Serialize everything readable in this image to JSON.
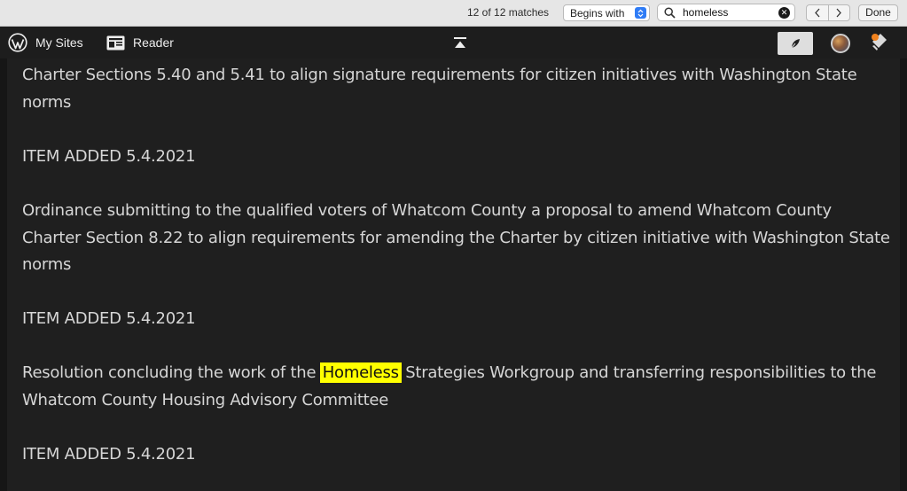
{
  "findbar": {
    "match_count": "12 of 12 matches",
    "mode": "Begins with",
    "query": "homeless",
    "done_label": "Done"
  },
  "adminbar": {
    "my_sites": "My Sites",
    "reader": "Reader"
  },
  "content": {
    "block1_line1": "Charter Sections 5.40 and 5.41 to align signature requirements for citizen initiatives with Washington State",
    "block1_line2": "norms",
    "item_added_1": "ITEM ADDED 5.4.2021",
    "block2_line1": "Ordinance submitting to the qualified voters of Whatcom County a proposal to amend Whatcom County",
    "block2_line2": "Charter Section 8.22 to align requirements for amending the Charter by citizen initiative with Washington State",
    "block2_line3": "norms",
    "item_added_2": "ITEM ADDED 5.4.2021",
    "block3_pre": "Resolution concluding the work of the ",
    "block3_highlight": "Homeless",
    "block3_post": " Strategies Workgroup and transferring responsibilities to the",
    "block3_line2": "Whatcom County Housing Advisory Committee",
    "item_added_3": "ITEM ADDED 5.4.2021"
  },
  "colors": {
    "background": "#1f1f1f",
    "text": "#d6d6d6",
    "highlight": "#ffff00",
    "accent": "#2f7cf6"
  }
}
